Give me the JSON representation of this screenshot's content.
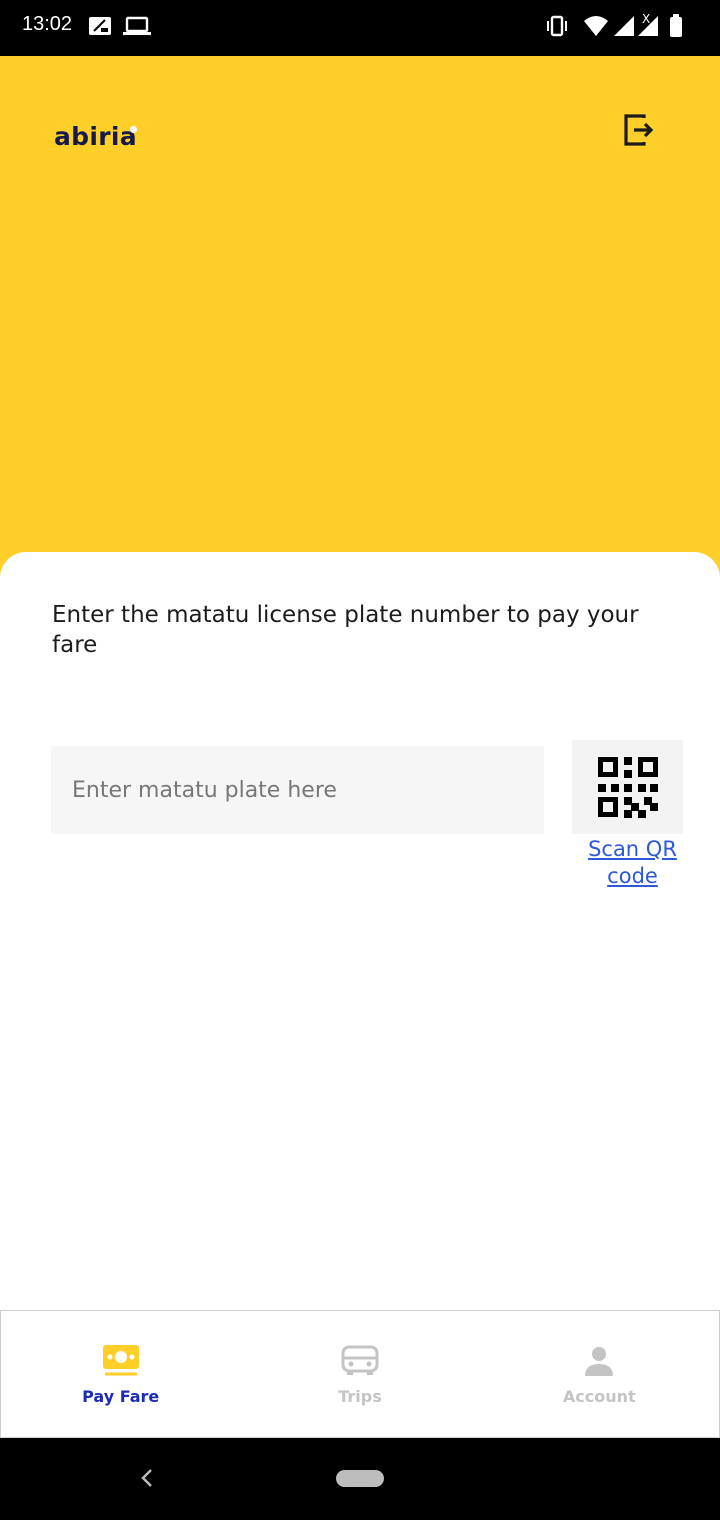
{
  "status_bar": {
    "time": "13:02",
    "left_icons": [
      "notification-icon",
      "laptop-icon"
    ],
    "right_icons": [
      "vibrate-icon",
      "wifi-icon",
      "signal-icon",
      "battery-icon"
    ]
  },
  "header": {
    "logo_text": "abiria",
    "logout_icon": "logout-icon",
    "background_color": "#fecf29"
  },
  "pay": {
    "prompt": "Enter the matatu license plate number to pay your fare",
    "plate_placeholder": "Enter matatu plate here",
    "plate_value": "",
    "qr_icon": "qr-code-icon",
    "qr_link_label": "Scan QR code",
    "link_color": "#2d58d6"
  },
  "bottom_nav": {
    "items": [
      {
        "label": "Pay Fare",
        "icon": "money-icon",
        "active": true
      },
      {
        "label": "Trips",
        "icon": "bus-icon",
        "active": false
      },
      {
        "label": "Account",
        "icon": "person-icon",
        "active": false
      }
    ],
    "active_color": "#1d2cb7",
    "inactive_color": "#c4c4c4",
    "active_icon_color": "#fecf29"
  },
  "system_nav": {
    "back_icon": "back-chevron-icon",
    "home_icon": "home-pill-icon"
  }
}
